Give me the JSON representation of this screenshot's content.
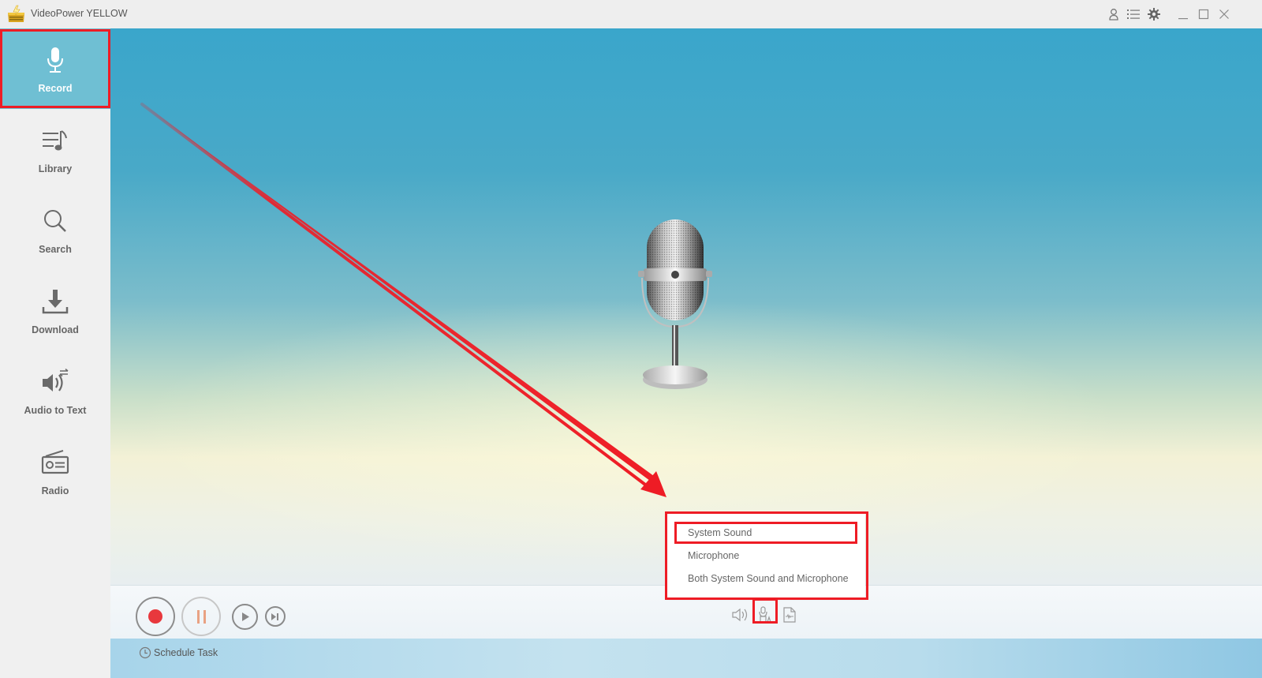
{
  "app": {
    "title": "VideoPower YELLOW",
    "titlebar_icons": [
      "user-icon",
      "list-icon",
      "settings-icon",
      "minimize-icon",
      "maximize-icon",
      "close-icon"
    ]
  },
  "sidebar": {
    "items": [
      {
        "label": "Record",
        "icon": "microphone-icon",
        "active": true
      },
      {
        "label": "Library",
        "icon": "music-list-icon",
        "active": false
      },
      {
        "label": "Search",
        "icon": "search-icon",
        "active": false
      },
      {
        "label": "Download",
        "icon": "download-icon",
        "active": false
      },
      {
        "label": "Audio to Text",
        "icon": "speaker-convert-icon",
        "active": false
      },
      {
        "label": "Radio",
        "icon": "radio-icon",
        "active": false
      }
    ]
  },
  "main": {
    "artwork": "vintage-microphone",
    "controls": {
      "record": "record-button",
      "pause": "pause-button",
      "play": "play-button",
      "next": "next-button"
    },
    "audio_source_icons": [
      "system-sound-icon",
      "microphone-source-icon",
      "audio-file-icon"
    ],
    "schedule_label": "Schedule Task"
  },
  "audio_source_menu": {
    "items": [
      {
        "label": "System Sound",
        "highlighted": true
      },
      {
        "label": "Microphone",
        "highlighted": false
      },
      {
        "label": "Both System Sound and Microphone",
        "highlighted": false
      }
    ]
  },
  "colors": {
    "accent_active": "#6fbfd3",
    "record_red": "#e8383d",
    "pause_orange": "#e9a283",
    "annotation_red": "#ee1c25"
  }
}
